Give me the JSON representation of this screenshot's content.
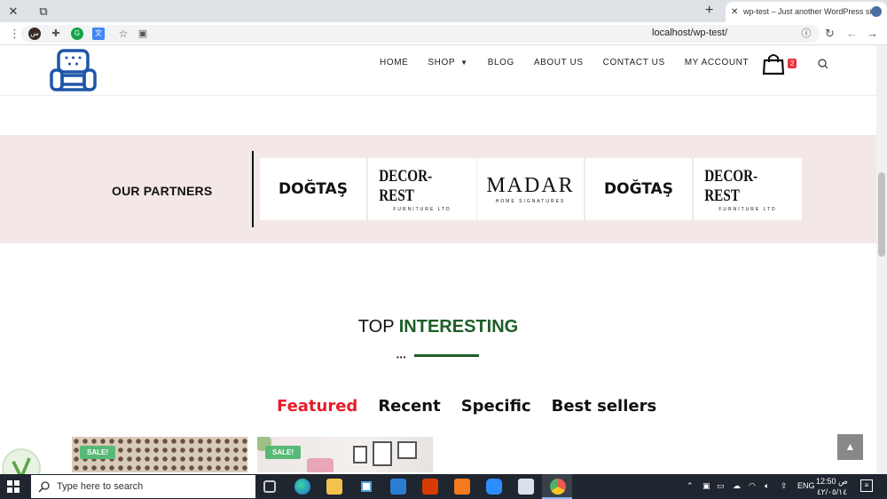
{
  "browser": {
    "tab_title": "wp-test – Just another WordPress site",
    "url": "localhost/wp-test/",
    "profile_initial": "س",
    "new_tab_glyph": "+",
    "close_glyph": "✕",
    "restore_glyph": "⧉"
  },
  "header": {
    "nav": [
      {
        "label": "HOME"
      },
      {
        "label": "SHOP"
      },
      {
        "label": "BLOG"
      },
      {
        "label": "ABOUT US"
      },
      {
        "label": "CONTACT US"
      },
      {
        "label": "MY ACCOUNT"
      }
    ],
    "cart_count": "2",
    "brand_color": "#1f55a8"
  },
  "partners": {
    "title": "OUR PARTNERS",
    "logos": [
      {
        "name": "DOĞTAŞ",
        "sub": ""
      },
      {
        "name": "DECOR-REST",
        "sub": "FURNITURE LTD"
      },
      {
        "name": "MADAR",
        "sub": "HOME SIGNATURES"
      },
      {
        "name": "DOĞTAŞ",
        "sub": ""
      },
      {
        "name": "DECOR-REST",
        "sub": "FURNITURE LTD"
      }
    ],
    "background": "#f3e8e7"
  },
  "products_section": {
    "title_plain": "TOP ",
    "title_accent": "INTERESTING",
    "accent_color": "#1d5e27",
    "tabs": [
      {
        "label": "Featured",
        "active": true
      },
      {
        "label": "Recent",
        "active": false
      },
      {
        "label": "Specific",
        "active": false
      },
      {
        "label": "Best sellers",
        "active": false
      }
    ],
    "badge": "SALE!"
  },
  "scroll_top_glyph": "▲",
  "taskbar": {
    "search_placeholder": "Type here to search",
    "lang": "ENG",
    "time": "12:50 ص",
    "date": "٤٢/٠٥/١٤"
  }
}
